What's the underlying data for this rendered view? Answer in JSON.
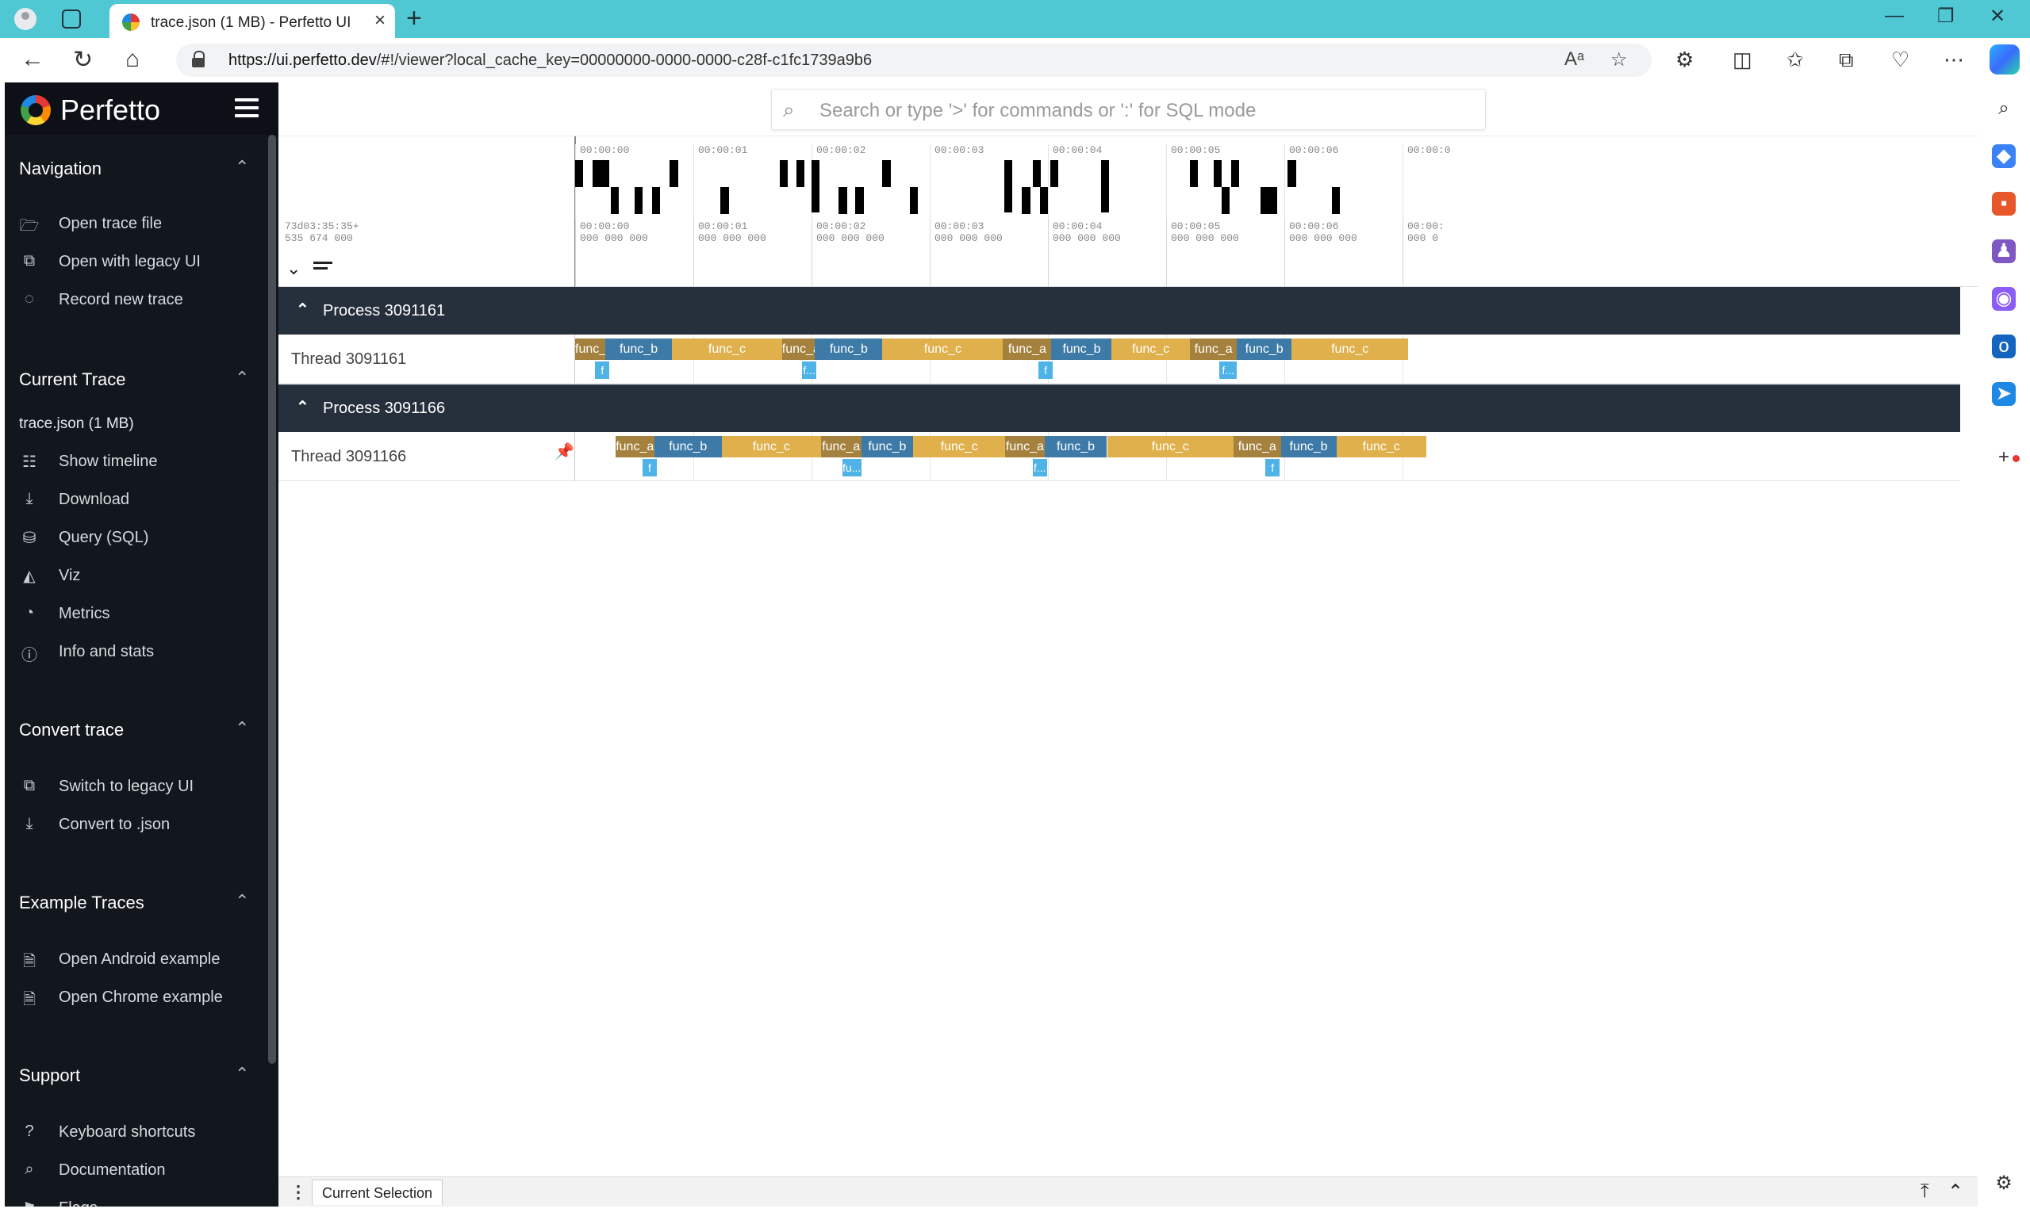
{
  "browser": {
    "tab_title": "trace.json (1 MB) - Perfetto UI",
    "tab_close": "×",
    "new_tab": "+",
    "url_host": "https://ui.perfetto.dev",
    "url_path": "/#!/viewer?local_cache_key=00000000-0000-0000-c28f-c1fc1739a9b6",
    "window_controls": [
      "—",
      "❐",
      "✕"
    ]
  },
  "sidebar": {
    "brand": "Perfetto",
    "sections": [
      {
        "title": "Navigation",
        "items": [
          {
            "icon": "folder-open-icon",
            "glyph": "🗁",
            "label": "Open trace file"
          },
          {
            "icon": "legacy-ui-icon",
            "glyph": "⧉",
            "label": "Open with legacy UI"
          },
          {
            "icon": "record-icon",
            "glyph": "◌",
            "label": "Record new trace"
          }
        ]
      },
      {
        "title": "Current Trace",
        "subtitle": "trace.json (1 MB)",
        "items": [
          {
            "icon": "timeline-icon",
            "glyph": "☷",
            "label": "Show timeline"
          },
          {
            "icon": "download-icon",
            "glyph": "⤓",
            "label": "Download"
          },
          {
            "icon": "database-icon",
            "glyph": "⛁",
            "label": "Query (SQL)"
          },
          {
            "icon": "viz-icon",
            "glyph": "◭",
            "label": "Viz"
          },
          {
            "icon": "metrics-icon",
            "glyph": "◔",
            "label": "Metrics"
          },
          {
            "icon": "info-icon",
            "glyph": "ⓘ",
            "label": "Info and stats"
          }
        ]
      },
      {
        "title": "Convert trace",
        "items": [
          {
            "icon": "legacy-ui-icon",
            "glyph": "⧉",
            "label": "Switch to legacy UI"
          },
          {
            "icon": "download-icon",
            "glyph": "⤓",
            "label": "Convert to .json"
          }
        ]
      },
      {
        "title": "Example Traces",
        "items": [
          {
            "icon": "file-icon",
            "glyph": "🗎",
            "label": "Open Android example"
          },
          {
            "icon": "file-icon",
            "glyph": "🗎",
            "label": "Open Chrome example"
          }
        ]
      },
      {
        "title": "Support",
        "items": [
          {
            "icon": "help-icon",
            "glyph": "?",
            "label": "Keyboard shortcuts"
          },
          {
            "icon": "docs-icon",
            "glyph": "⌕",
            "label": "Documentation"
          },
          {
            "icon": "flags-icon",
            "glyph": "⚑",
            "label": "Flags"
          }
        ]
      }
    ]
  },
  "omnibox": {
    "placeholder": "Search or type '>' for commands or ':' for SQL mode"
  },
  "timeline": {
    "offset_label": "73d03:35:35+\n535 674 000",
    "overview_ticks": [
      "00:00:00",
      "00:00:01",
      "00:00:02",
      "00:00:03",
      "00:00:04",
      "00:00:05",
      "00:00:06",
      "00:00:0"
    ],
    "ruler_ticks": [
      "00:00:00\n000 000 000",
      "00:00:01\n000 000 000",
      "00:00:02\n000 000 000",
      "00:00:03\n000 000 000",
      "00:00:04\n000 000 000",
      "00:00:05\n000 000 000",
      "00:00:06\n000 000 000",
      "00:00:\n000 0"
    ]
  },
  "processes": [
    {
      "name": "Process 3091161",
      "thread": "Thread 3091161",
      "pinned": false,
      "slices": [
        {
          "name": "func_a",
          "start": 0.0,
          "end": 0.255,
          "color": "#a5813e"
        },
        {
          "name": "func_b",
          "start": 0.255,
          "end": 0.82,
          "color": "#3d7aa8"
        },
        {
          "name": "func_c",
          "start": 0.82,
          "end": 1.75,
          "color": "#dfb04c"
        },
        {
          "name": "func_a",
          "start": 1.75,
          "end": 2.03,
          "color": "#a5813e"
        },
        {
          "name": "func_b",
          "start": 2.03,
          "end": 2.6,
          "color": "#3d7aa8"
        },
        {
          "name": "func_c",
          "start": 2.6,
          "end": 3.62,
          "color": "#dfb04c"
        },
        {
          "name": "func_a",
          "start": 3.62,
          "end": 4.03,
          "color": "#a5813e"
        },
        {
          "name": "func_b",
          "start": 4.03,
          "end": 4.54,
          "color": "#3d7aa8"
        },
        {
          "name": "func_c",
          "start": 4.54,
          "end": 5.2,
          "color": "#dfb04c"
        },
        {
          "name": "func_a",
          "start": 5.2,
          "end": 5.6,
          "color": "#a5813e"
        },
        {
          "name": "func_b",
          "start": 5.6,
          "end": 6.06,
          "color": "#3d7aa8"
        },
        {
          "name": "func_c",
          "start": 6.06,
          "end": 7.05,
          "color": "#dfb04c"
        }
      ],
      "sub_slices": [
        {
          "name": "f",
          "start": 0.17,
          "end": 0.27
        },
        {
          "name": "f...",
          "start": 1.92,
          "end": 2.03
        },
        {
          "name": "f",
          "start": 3.92,
          "end": 4.02
        },
        {
          "name": "f...",
          "start": 5.45,
          "end": 5.6
        }
      ]
    },
    {
      "name": "Process 3091166",
      "thread": "Thread 3091166",
      "pinned": true,
      "slices": [
        {
          "name": "func_a",
          "start": 0.34,
          "end": 0.67,
          "color": "#a5813e"
        },
        {
          "name": "func_b",
          "start": 0.67,
          "end": 1.24,
          "color": "#3d7aa8"
        },
        {
          "name": "func_c",
          "start": 1.24,
          "end": 2.08,
          "color": "#dfb04c"
        },
        {
          "name": "func_a",
          "start": 2.08,
          "end": 2.42,
          "color": "#a5813e"
        },
        {
          "name": "func_b",
          "start": 2.42,
          "end": 2.86,
          "color": "#3d7aa8"
        },
        {
          "name": "func_c",
          "start": 2.86,
          "end": 3.64,
          "color": "#dfb04c"
        },
        {
          "name": "func_a",
          "start": 3.64,
          "end": 3.97,
          "color": "#a5813e"
        },
        {
          "name": "func_b",
          "start": 3.97,
          "end": 4.5,
          "color": "#3d7aa8"
        },
        {
          "name": "func_c",
          "start": 4.5,
          "end": 5.57,
          "color": "#dfb04c"
        },
        {
          "name": "func_a",
          "start": 5.57,
          "end": 5.97,
          "color": "#a5813e"
        },
        {
          "name": "func_b",
          "start": 5.97,
          "end": 6.44,
          "color": "#3d7aa8"
        },
        {
          "name": "func_c",
          "start": 6.44,
          "end": 7.2,
          "color": "#dfb04c"
        }
      ],
      "sub_slices": [
        {
          "name": "f",
          "start": 0.57,
          "end": 0.67
        },
        {
          "name": "fu...",
          "start": 2.26,
          "end": 2.42
        },
        {
          "name": "f...",
          "start": 3.87,
          "end": 3.97
        },
        {
          "name": "f",
          "start": 5.84,
          "end": 5.94
        }
      ]
    }
  ],
  "overview_activity": [
    {
      "t": 0.0,
      "w": 0.07,
      "row": 0
    },
    {
      "t": 0.15,
      "w": 0.14,
      "row": 0
    },
    {
      "t": 0.3,
      "w": 0.07,
      "row": 1
    },
    {
      "t": 0.5,
      "w": 0.07,
      "row": 1
    },
    {
      "t": 0.65,
      "w": 0.07,
      "row": 1
    },
    {
      "t": 0.8,
      "w": 0.07,
      "row": 0
    },
    {
      "t": 1.23,
      "w": 0.07,
      "row": 1
    },
    {
      "t": 1.73,
      "w": 0.07,
      "row": 0
    },
    {
      "t": 1.87,
      "w": 0.07,
      "row": 0
    },
    {
      "t": 2.0,
      "w": 0.07,
      "row": 2
    },
    {
      "t": 2.23,
      "w": 0.07,
      "row": 1
    },
    {
      "t": 2.37,
      "w": 0.07,
      "row": 1
    },
    {
      "t": 2.6,
      "w": 0.07,
      "row": 0
    },
    {
      "t": 2.83,
      "w": 0.07,
      "row": 1
    },
    {
      "t": 3.63,
      "w": 0.07,
      "row": 2
    },
    {
      "t": 3.78,
      "w": 0.07,
      "row": 1
    },
    {
      "t": 3.87,
      "w": 0.07,
      "row": 0
    },
    {
      "t": 3.93,
      "w": 0.07,
      "row": 1
    },
    {
      "t": 4.02,
      "w": 0.07,
      "row": 0
    },
    {
      "t": 4.45,
      "w": 0.07,
      "row": 2
    },
    {
      "t": 5.2,
      "w": 0.07,
      "row": 0
    },
    {
      "t": 5.4,
      "w": 0.07,
      "row": 0
    },
    {
      "t": 5.47,
      "w": 0.07,
      "row": 1
    },
    {
      "t": 5.55,
      "w": 0.07,
      "row": 0
    },
    {
      "t": 5.8,
      "w": 0.14,
      "row": 1
    },
    {
      "t": 6.03,
      "w": 0.07,
      "row": 0
    },
    {
      "t": 6.4,
      "w": 0.07,
      "row": 1
    }
  ],
  "bottom": {
    "tab_label": "Current Selection"
  },
  "colors": {
    "func_a": "#a5813e",
    "func_b": "#3d7aa8",
    "func_c": "#dfb04c",
    "sub_slice": "#4fb3e8",
    "process_header": "#262f3c"
  }
}
